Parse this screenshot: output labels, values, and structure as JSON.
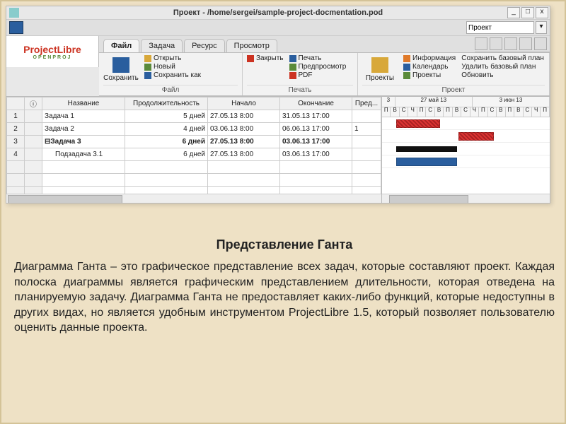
{
  "window": {
    "title": "Проект - /home/sergei/sample-project-docmentation.pod",
    "min": "_",
    "max": "□",
    "close": "x"
  },
  "logo": {
    "main": "ProjectLibre",
    "sub": "OPENPROJ"
  },
  "combo": {
    "value": "Проект"
  },
  "tabs": {
    "file": "Файл",
    "task": "Задача",
    "resource": "Ресурс",
    "view": "Просмотр"
  },
  "ribbon": {
    "file": {
      "save": "Сохранить",
      "open": "Открыть",
      "new": "Новый",
      "saveas": "Сохранить как",
      "group": "Файл"
    },
    "print": {
      "close": "Закрыть",
      "print": "Печать",
      "preview": "Предпросмотр",
      "pdf": "PDF",
      "group": "Печать"
    },
    "project": {
      "projects": "Проекты",
      "info": "Информация",
      "calendar": "Календарь",
      "projs": "Проекты",
      "savebase": "Сохранить базовый план",
      "delbase": "Удалить базовый план",
      "refresh": "Обновить",
      "group": "Проект"
    }
  },
  "columns": {
    "num": " ",
    "info": " ",
    "name": "Название",
    "duration": "Продолжительность",
    "start": "Начало",
    "finish": "Окончание",
    "pred": "Пред..."
  },
  "tasks": [
    {
      "n": "1",
      "name": "Задача 1",
      "dur": "5 дней",
      "start": "27.05.13 8:00",
      "finish": "31.05.13 17:00",
      "pred": ""
    },
    {
      "n": "2",
      "name": "Задача 2",
      "dur": "4 дней",
      "start": "03.06.13 8:00",
      "finish": "06.06.13 17:00",
      "pred": "1"
    },
    {
      "n": "3",
      "name": "⊟Задача 3",
      "dur": "6 дней",
      "start": "27.05.13 8:00",
      "finish": "03.06.13 17:00",
      "pred": "",
      "bold": true
    },
    {
      "n": "4",
      "name": "Подзадача 3.1",
      "dur": "6 дней",
      "start": "27.05.13 8:00",
      "finish": "03.06.13 17:00",
      "pred": "",
      "indent": true
    }
  ],
  "timeline": {
    "majors": [
      "3",
      "27 май 13",
      "3 июн 13"
    ],
    "day_cells": [
      "П",
      "В",
      "С",
      "Ч",
      "П",
      "С",
      "В",
      "П",
      "В",
      "С",
      "Ч",
      "П",
      "С",
      "В",
      "П",
      "В",
      "С",
      "Ч",
      "П"
    ]
  },
  "article": {
    "title": "Представление Ганта",
    "body": "Диаграмма Ганта – это графическое представление всех задач, которые составляют проект. Каждая полоска диаграммы является графическим представлением длительности, которая отведена на планируемую задачу. Диаграмма Ганта не предоставляет каких-либо функций, которые недоступны в других видах, но является удобным инструментом ProjectLibre 1.5, который позволяет пользователю оценить данные проекта."
  }
}
